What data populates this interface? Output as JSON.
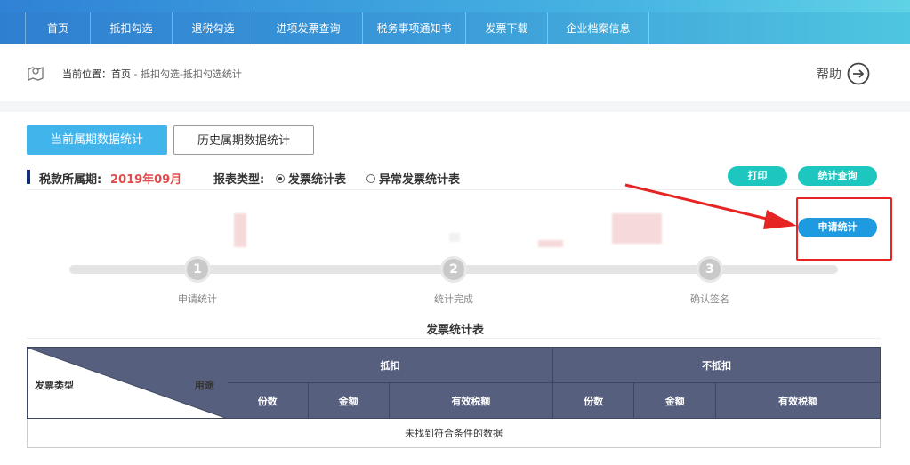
{
  "nav": {
    "items": [
      {
        "label": "首页",
        "width": 74
      },
      {
        "label": "抵扣勾选",
        "width": 92
      },
      {
        "label": "退税勾选",
        "width": 92
      },
      {
        "label": "进项发票查询",
        "width": 122
      },
      {
        "label": "税务事项通知书",
        "width": 116
      },
      {
        "label": "发票下载",
        "width": 92
      },
      {
        "label": "企业档案信息",
        "width": 114
      }
    ]
  },
  "breadcrumb": {
    "prefix": "当前位置：",
    "home": "首页",
    "path": " - 抵扣勾选-抵扣勾选统计"
  },
  "help": {
    "label": "帮助"
  },
  "tabs": {
    "current": "当前属期数据统计",
    "history": "历史属期数据统计"
  },
  "filter": {
    "period_label": "税款所属期:",
    "period_value": "2019年09月",
    "report_label": "报表类型:",
    "option_invoice": "发票统计表",
    "option_abnormal": "异常发票统计表"
  },
  "actions": {
    "print": "打印",
    "query": "统计查询",
    "apply": "申请统计"
  },
  "steps": [
    {
      "num": "1",
      "label": "申请统计"
    },
    {
      "num": "2",
      "label": "统计完成"
    },
    {
      "num": "3",
      "label": "确认签名"
    }
  ],
  "table": {
    "title": "发票统计表",
    "diag_left": "发票类型",
    "diag_right": "用途",
    "group_deduct": "抵扣",
    "group_nondeduct": "不抵扣",
    "col_count": "份数",
    "col_amount": "金额",
    "col_tax": "有效税额",
    "empty": "未找到符合条件的数据"
  },
  "colors": {
    "accent": "#42b4ec",
    "teal": "#1ec6c0",
    "header": "#565f7e",
    "highlight": "#e62424"
  }
}
